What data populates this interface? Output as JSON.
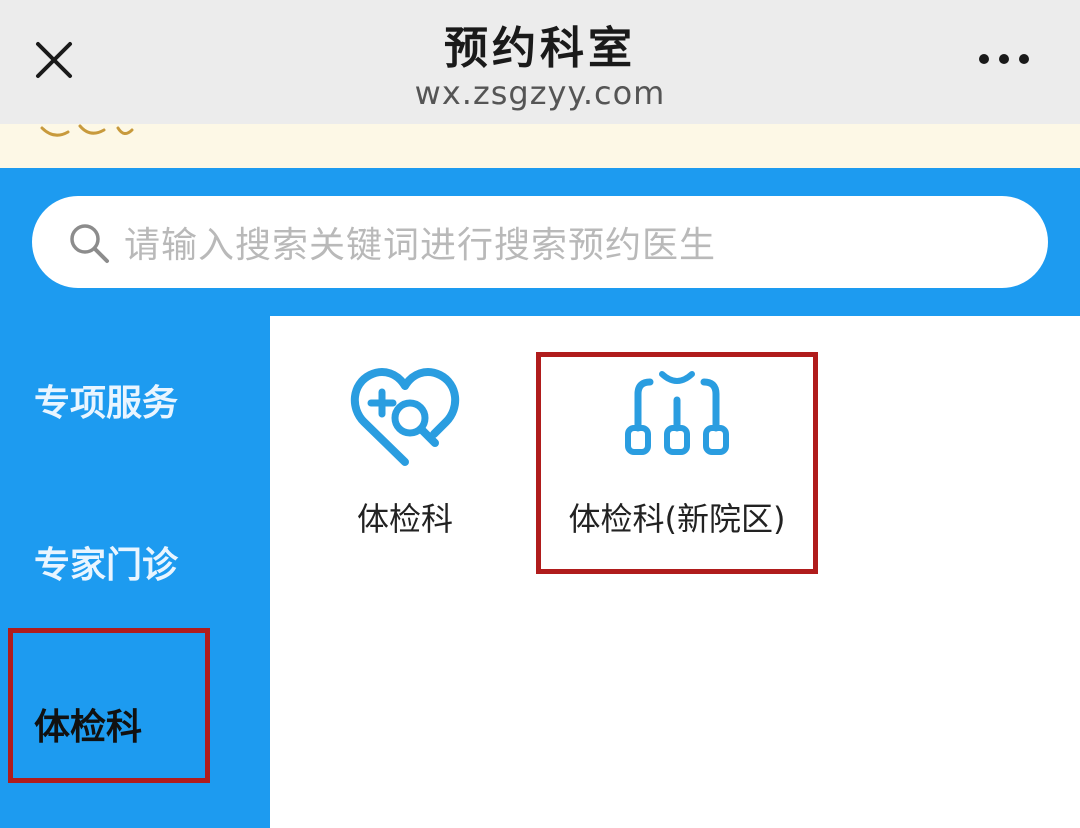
{
  "header": {
    "title": "预约科室",
    "domain": "wx.zsgzyy.com",
    "close_icon": "close-icon",
    "more_icon": "more-icon"
  },
  "search": {
    "placeholder": "请输入搜索关键词进行搜索预约医生",
    "icon": "search-icon"
  },
  "sidebar": {
    "items": [
      {
        "label": "专项服务",
        "active": false
      },
      {
        "label": "专家门诊",
        "active": false
      },
      {
        "label": "体检科",
        "active": true
      }
    ]
  },
  "departments": [
    {
      "label": "体检科",
      "icon": "heart-search-icon"
    },
    {
      "label": "体检科(新院区)",
      "icon": "branch-network-icon"
    }
  ],
  "colors": {
    "accent_blue": "#1d9bf0",
    "icon_blue": "#2a9de0",
    "highlight_red": "#b01c1c",
    "topbar_gray": "#ececec",
    "notice_cream": "#fdf8e6"
  }
}
